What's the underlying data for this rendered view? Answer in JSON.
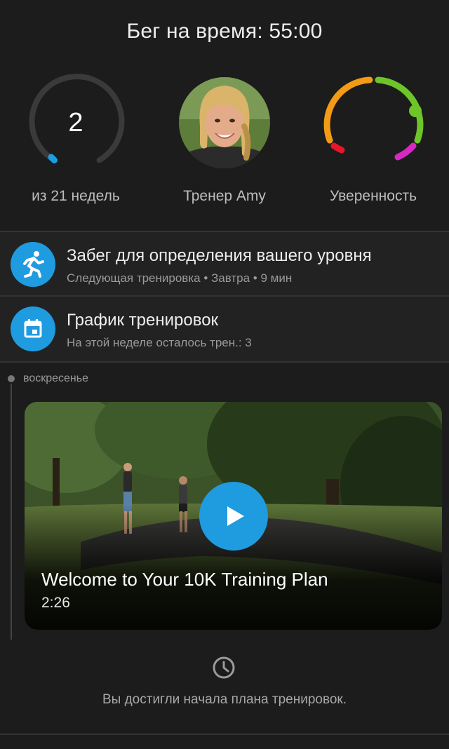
{
  "header": {
    "title": "Бег на время: 55:00"
  },
  "stats": {
    "weeks": {
      "current": "2",
      "caption": "из 21 недель",
      "progress": 0.05,
      "ring_color": "#3a3a3a",
      "progress_color": "#1f9be0"
    },
    "coach": {
      "caption": "Тренер Amy"
    },
    "confidence": {
      "caption": "Уверенность",
      "colors": [
        "#e8162b",
        "#f39a16",
        "#6ec52a",
        "#d42ac1"
      ]
    }
  },
  "rows": [
    {
      "icon": "running-icon",
      "title": "Забег для определения вашего уровня",
      "subtitle": "Следующая тренировка • Завтра • 9 мин"
    },
    {
      "icon": "calendar-icon",
      "title": "График тренировок",
      "subtitle": "На этой неделе осталось трен.: 3"
    }
  ],
  "timeline": {
    "day": "воскресенье",
    "video": {
      "title": "Welcome to Your 10K Training Plan",
      "duration": "2:26",
      "icon": "play-icon"
    }
  },
  "footer": {
    "icon": "clock-icon",
    "text": "Вы достигли начала плана тренировок."
  },
  "colors": {
    "accent": "#1f9be0",
    "background": "#1c1c1c",
    "row_background": "#222222"
  }
}
